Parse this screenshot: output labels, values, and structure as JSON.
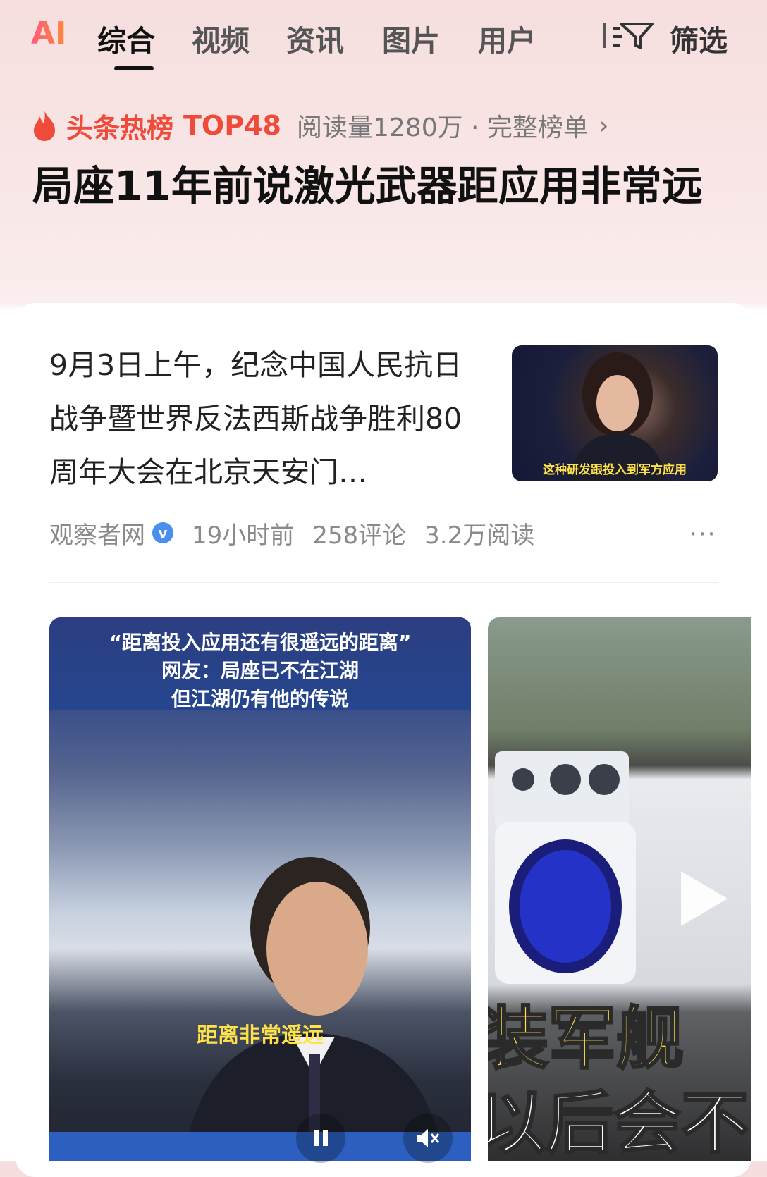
{
  "tabs": {
    "ai_logo": "AI",
    "items": [
      {
        "label": "综合",
        "active": true
      },
      {
        "label": "视频",
        "active": false
      },
      {
        "label": "资讯",
        "active": false
      },
      {
        "label": "图片",
        "active": false
      },
      {
        "label": "用户",
        "active": false
      }
    ],
    "filter_label": "筛选"
  },
  "hot": {
    "title": "头条热榜",
    "rank": "TOP48",
    "meta": "阅读量1280万 · 完整榜单",
    "chevron": "›"
  },
  "headline": "局座11年前说激光武器距应用非常远",
  "article": {
    "summary": "9月3日上午，纪念中国人民抗日战争暨世界反法西斯战争胜利80周年大会在北京天安门…",
    "thumb_caption": "这种研发跟投入到军方应用",
    "source": "观察者网",
    "verify_mark": "v",
    "time": "19小时前",
    "comments": "258评论",
    "reads": "3.2万阅读",
    "more": "···"
  },
  "video1": {
    "line1": "“距离投入应用还有很遥远的距离”",
    "line2": "网友：局座已不在江湖",
    "line3": "但江湖仍有他的传说",
    "subtitle": "距离非常遥远"
  },
  "video2": {
    "overlay1": "装军舰",
    "overlay2": "以后会不"
  },
  "colors": {
    "hot_red": "#f04a3a",
    "caption_yellow": "#ffe24a",
    "verify_blue": "#4a8ef0"
  }
}
